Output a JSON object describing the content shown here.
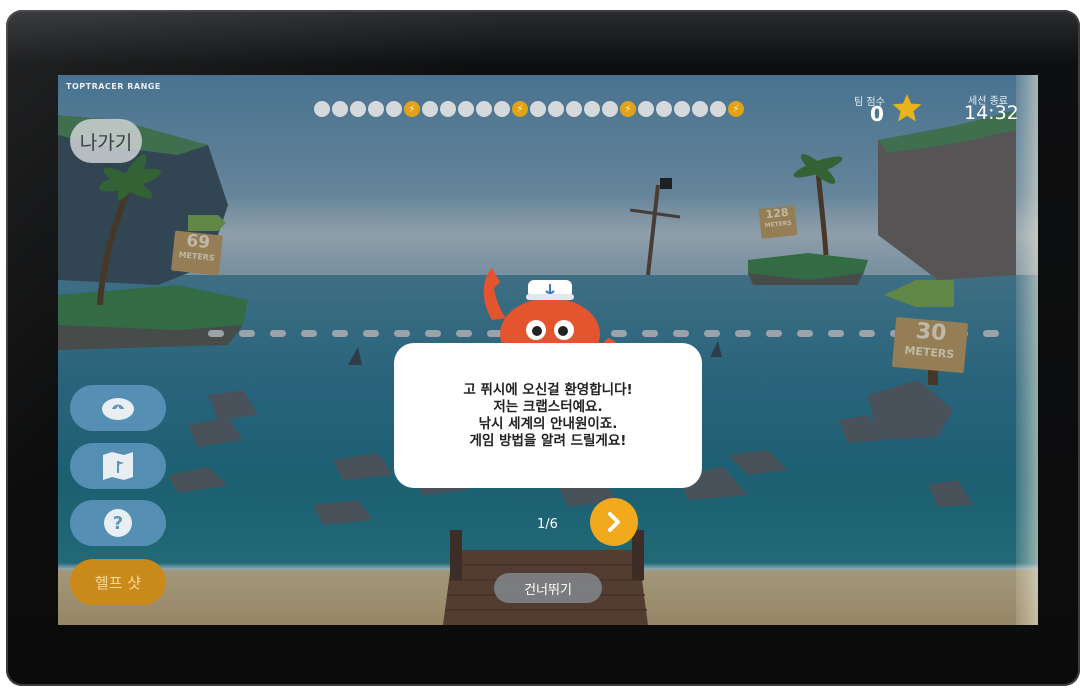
{
  "header": {
    "brand": "TOPTRACER RANGE",
    "progress": {
      "dots": [
        "dot",
        "dot",
        "dot",
        "dot",
        "dot",
        "bolt",
        "dot",
        "dot",
        "dot",
        "dot",
        "dot",
        "bolt",
        "dot",
        "dot",
        "dot",
        "dot",
        "dot",
        "bolt",
        "dot",
        "dot",
        "dot",
        "dot",
        "dot",
        "bolt"
      ]
    },
    "score_label": "팀 점수",
    "score_value": "0",
    "time_label": "세션 종료",
    "time_value": "14:32"
  },
  "buttons": {
    "exit": "나가기",
    "help": "헬프 샷",
    "skip": "건너뛰기"
  },
  "side_buttons": [
    {
      "name": "bag-icon"
    },
    {
      "name": "map-icon"
    },
    {
      "name": "question-icon"
    }
  ],
  "dialog": {
    "lines": [
      "고 퓌시에 오신걸 환영합니다!",
      "저는 크랩스터예요.",
      "낚시 세계의 안내원이죠.",
      "게임 방법을 알려 드릴게요!"
    ],
    "page": "1/6"
  },
  "signs": {
    "left": {
      "number": "69",
      "unit": "METERS"
    },
    "mid": {
      "number": "128",
      "unit": "METERS"
    },
    "right": {
      "number": "30",
      "unit": "METERS"
    }
  },
  "colors": {
    "accent": "#f2a91c",
    "help": "#c98a1a",
    "side_button": "#5f96be",
    "star": "#e9b31a"
  }
}
